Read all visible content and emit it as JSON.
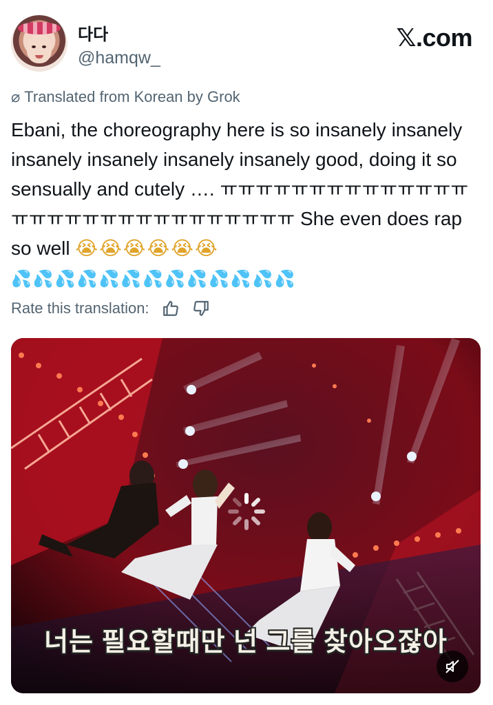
{
  "author": {
    "display_name": "다다",
    "handle": "@hamqw_"
  },
  "brand": {
    "x_glyph": "𝕏",
    "suffix": ".com"
  },
  "translation": {
    "notice": "Translated from Korean by Grok",
    "icon": "no-translate-icon"
  },
  "post": {
    "text_main": "Ebani, the choreography here is so insanely insanely insanely insanely insanely insanely good, doing it so sensually and cutely …. ㅠㅠㅠㅠㅠㅠㅠㅠㅠㅠㅠㅠㅠㅠ ㅠㅠㅠㅠㅠㅠㅠㅠㅠㅠㅠㅠㅠㅠㅠㅠ She even does rap so well",
    "emoji_sob": "😭😭😭😭😭😭",
    "emoji_drops": "💦💦💦💦💦💦💦💦💦💦💦💦💦"
  },
  "rating": {
    "label": "Rate this translation:",
    "icons": [
      "thumbs-up-icon",
      "thumbs-down-icon"
    ]
  },
  "media": {
    "subtitle": "너는 필요할때만 넌 그를 찾아오잖아",
    "muted": true
  },
  "colors": {
    "text": "#0f1419",
    "secondary": "#536471",
    "stage_red": "#c01a28"
  }
}
